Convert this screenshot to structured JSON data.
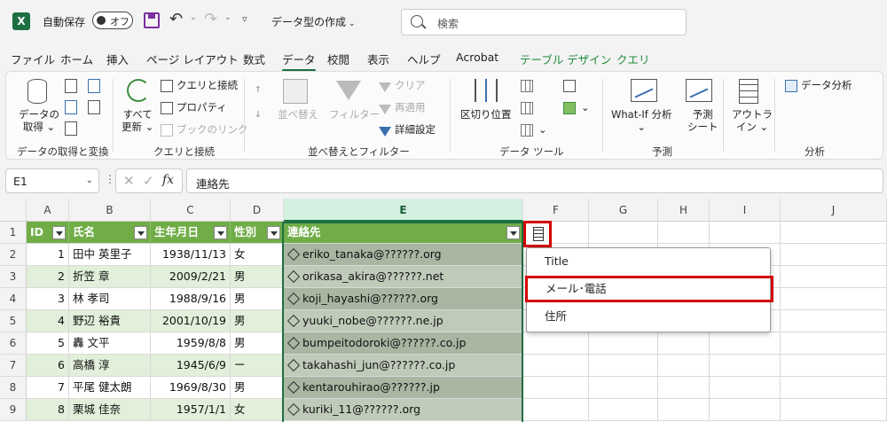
{
  "titlebar": {
    "logo": "X",
    "autosave_label": "自動保存",
    "autosave_state": "オフ",
    "undo": "↶",
    "redo": "↷",
    "caret": "⌄",
    "qat_more": "▿",
    "doc_title": "データ型の作成",
    "doc_chevron": "⌄",
    "search_placeholder": "検索"
  },
  "tabs": [
    {
      "label": "ファイル"
    },
    {
      "label": "ホーム"
    },
    {
      "label": "挿入"
    },
    {
      "label": "ページ レイアウト"
    },
    {
      "label": "数式"
    },
    {
      "label": "データ"
    },
    {
      "label": "校閲"
    },
    {
      "label": "表示"
    },
    {
      "label": "ヘルプ"
    },
    {
      "label": "Acrobat"
    },
    {
      "label": "テーブル デザイン"
    },
    {
      "label": "クエリ"
    }
  ],
  "ribbon": {
    "get_data": {
      "line1": "データの",
      "line2": "取得 ⌄"
    },
    "refresh_all": {
      "line1": "すべて",
      "line2": "更新 ⌄"
    },
    "queries_connections": "クエリと接続",
    "properties": "プロパティ",
    "edit_links": "ブックのリンク",
    "sort": "並べ替え",
    "filter": "フィルター",
    "clear": "クリア",
    "reapply": "再適用",
    "advanced": "詳細設定",
    "text_to_columns": "区切り位置",
    "whatif": {
      "line1": "What-If 分析",
      "line2": "⌄"
    },
    "forecast": {
      "line1": "予測",
      "line2": "シート"
    },
    "outline": {
      "line1": "アウトラ",
      "line2": "イン ⌄"
    },
    "data_analysis": "データ分析",
    "group_labels": {
      "get_transform": "データの取得と変換",
      "queries": "クエリと接続",
      "sort_filter": "並べ替えとフィルター",
      "data_tools": "データ ツール",
      "forecast": "予測",
      "analysis": "分析"
    }
  },
  "formula_bar": {
    "name_box": "E1",
    "name_chevron": "⌄",
    "dots": "⋮",
    "cancel": "✕",
    "enter": "✓",
    "fx": "fx",
    "content": "連絡先"
  },
  "columns": [
    "A",
    "B",
    "C",
    "D",
    "E",
    "F",
    "G",
    "H",
    "I",
    "J"
  ],
  "rows": [
    "1",
    "2",
    "3",
    "4",
    "5",
    "6",
    "7",
    "8",
    "9"
  ],
  "table": {
    "headers": [
      "ID",
      "氏名",
      "生年月日",
      "性別",
      "連絡先"
    ],
    "records": [
      {
        "id": "1",
        "name": "田中 英里子",
        "birth": "1938/11/13",
        "gender": "女",
        "email": "eriko_tanaka@??????.org"
      },
      {
        "id": "2",
        "name": "折笠 章",
        "birth": "2009/2/21",
        "gender": "男",
        "email": "orikasa_akira@??????.net"
      },
      {
        "id": "3",
        "name": "林 孝司",
        "birth": "1988/9/16",
        "gender": "男",
        "email": "koji_hayashi@??????.org"
      },
      {
        "id": "4",
        "name": "野辺 裕貴",
        "birth": "2001/10/19",
        "gender": "男",
        "email": "yuuki_nobe@??????.ne.jp"
      },
      {
        "id": "5",
        "name": "轟 文平",
        "birth": "1959/8/8",
        "gender": "男",
        "email": "bumpeitodoroki@??????.co.jp"
      },
      {
        "id": "6",
        "name": "高橋 淳",
        "birth": "1945/6/9",
        "gender": "ー",
        "email": "takahashi_jun@??????.co.jp"
      },
      {
        "id": "7",
        "name": "平尾 健太朗",
        "birth": "1969/8/30",
        "gender": "男",
        "email": "kentarouhirao@??????.jp"
      },
      {
        "id": "8",
        "name": "栗城 佳奈",
        "birth": "1957/1/1",
        "gender": "女",
        "email": "kuriki_11@??????.org"
      }
    ]
  },
  "data_type_menu": {
    "items": [
      "Title",
      "メール･電話",
      "住所"
    ],
    "highlighted": "メール･電話"
  },
  "colors": {
    "accent": "#1d6f42",
    "table_header": "#70ad47",
    "band": "#e2efda",
    "highlight_box": "#d40000"
  }
}
